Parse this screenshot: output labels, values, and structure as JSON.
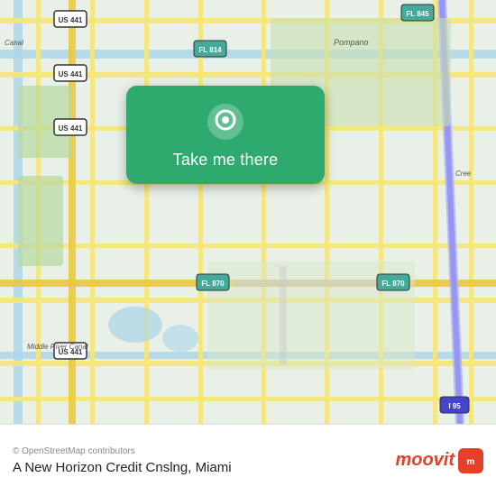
{
  "map": {
    "background_color": "#e8f0e8",
    "attribution": "© OpenStreetMap contributors"
  },
  "card": {
    "button_label": "Take me there",
    "background_color": "#2eaa6e"
  },
  "bottom_bar": {
    "attribution": "© OpenStreetMap contributors",
    "location_name": "A New Horizon Credit Cnslng, Miami"
  },
  "moovit": {
    "label": "moovit"
  }
}
